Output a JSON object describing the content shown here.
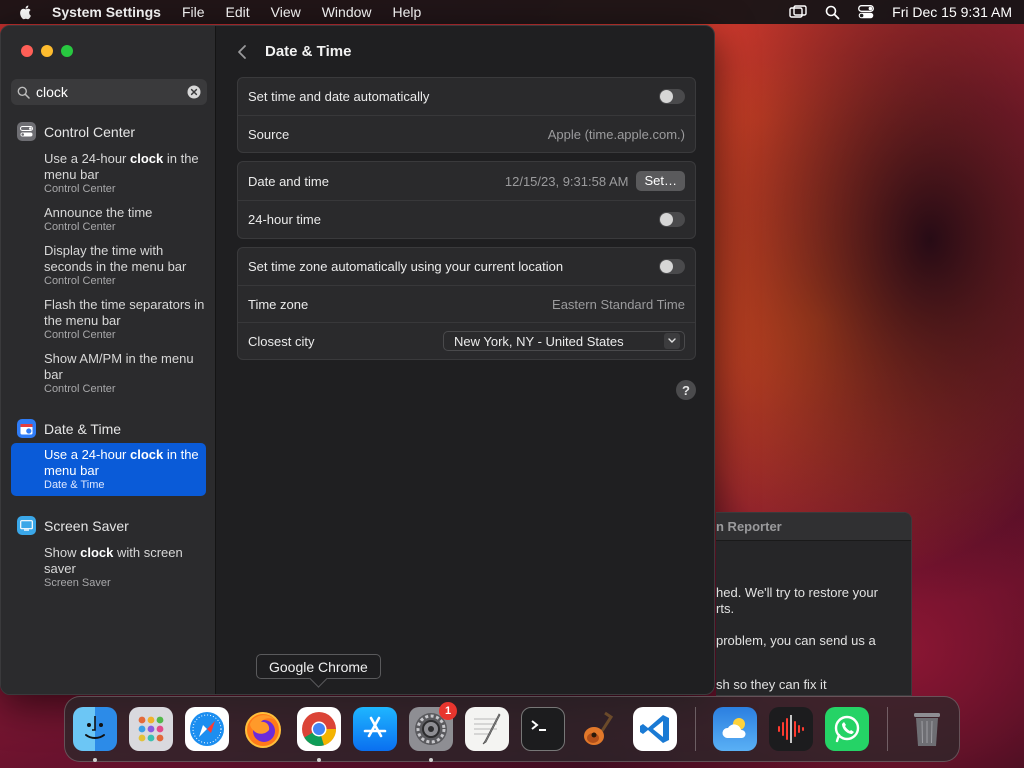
{
  "menubar": {
    "app_name": "System Settings",
    "menus": [
      "File",
      "Edit",
      "View",
      "Window",
      "Help"
    ],
    "clock": "Fri Dec 15  9:31 AM"
  },
  "sidebar": {
    "search_value": "clock",
    "sections": [
      {
        "title": "Control Center",
        "results": [
          {
            "pre": "Use a 24-hour ",
            "bold": "clock",
            "post": " in the menu bar",
            "sub": "Control Center"
          },
          {
            "pre": "Announce the time",
            "bold": "",
            "post": "",
            "sub": "Control Center"
          },
          {
            "pre": "Display the time with seconds in the menu bar",
            "bold": "",
            "post": "",
            "sub": "Control Center"
          },
          {
            "pre": "Flash the time separators in the menu bar",
            "bold": "",
            "post": "",
            "sub": "Control Center"
          },
          {
            "pre": "Show AM/PM in the menu bar",
            "bold": "",
            "post": "",
            "sub": "Control Center"
          }
        ]
      },
      {
        "title": "Date & Time",
        "results": [
          {
            "pre": "Use a 24-hour ",
            "bold": "clock",
            "post": " in the menu bar",
            "sub": "Date & Time",
            "selected": true
          }
        ]
      },
      {
        "title": "Screen Saver",
        "results": [
          {
            "pre": "Show ",
            "bold": "clock",
            "post": " with screen saver",
            "sub": "Screen Saver"
          }
        ]
      }
    ]
  },
  "content": {
    "title": "Date & Time",
    "card1": {
      "auto_label": "Set time and date automatically",
      "source_label": "Source",
      "source_value": "Apple (time.apple.com.)"
    },
    "card2": {
      "datetime_label": "Date and time",
      "datetime_value": "12/15/23, 9:31:58 AM",
      "set_button": "Set…",
      "hour24_label": "24-hour time"
    },
    "card3": {
      "tz_auto_label": "Set time zone automatically using your current location",
      "tz_label": "Time zone",
      "tz_value": "Eastern Standard Time",
      "city_label": "Closest city",
      "city_value": "New York, NY - United States"
    },
    "help": "?"
  },
  "reporter": {
    "title": "n Reporter",
    "line1": "hed. We'll try to restore your",
    "line2": "rts.",
    "line3": "problem, you can send us a",
    "line4": "sh so they can fix it"
  },
  "tooltip": "Google Chrome",
  "dock": {
    "badge_count": "1",
    "apps": [
      "finder-icon",
      "launchpad-icon",
      "safari-icon",
      "firefox-icon",
      "chrome-icon",
      "app-store-icon",
      "system-settings-icon",
      "textedit-icon",
      "terminal-icon",
      "garageband-icon",
      "vscode-icon",
      "weather-icon",
      "voice-memos-icon",
      "whatsapp-icon",
      "trash-icon"
    ]
  }
}
